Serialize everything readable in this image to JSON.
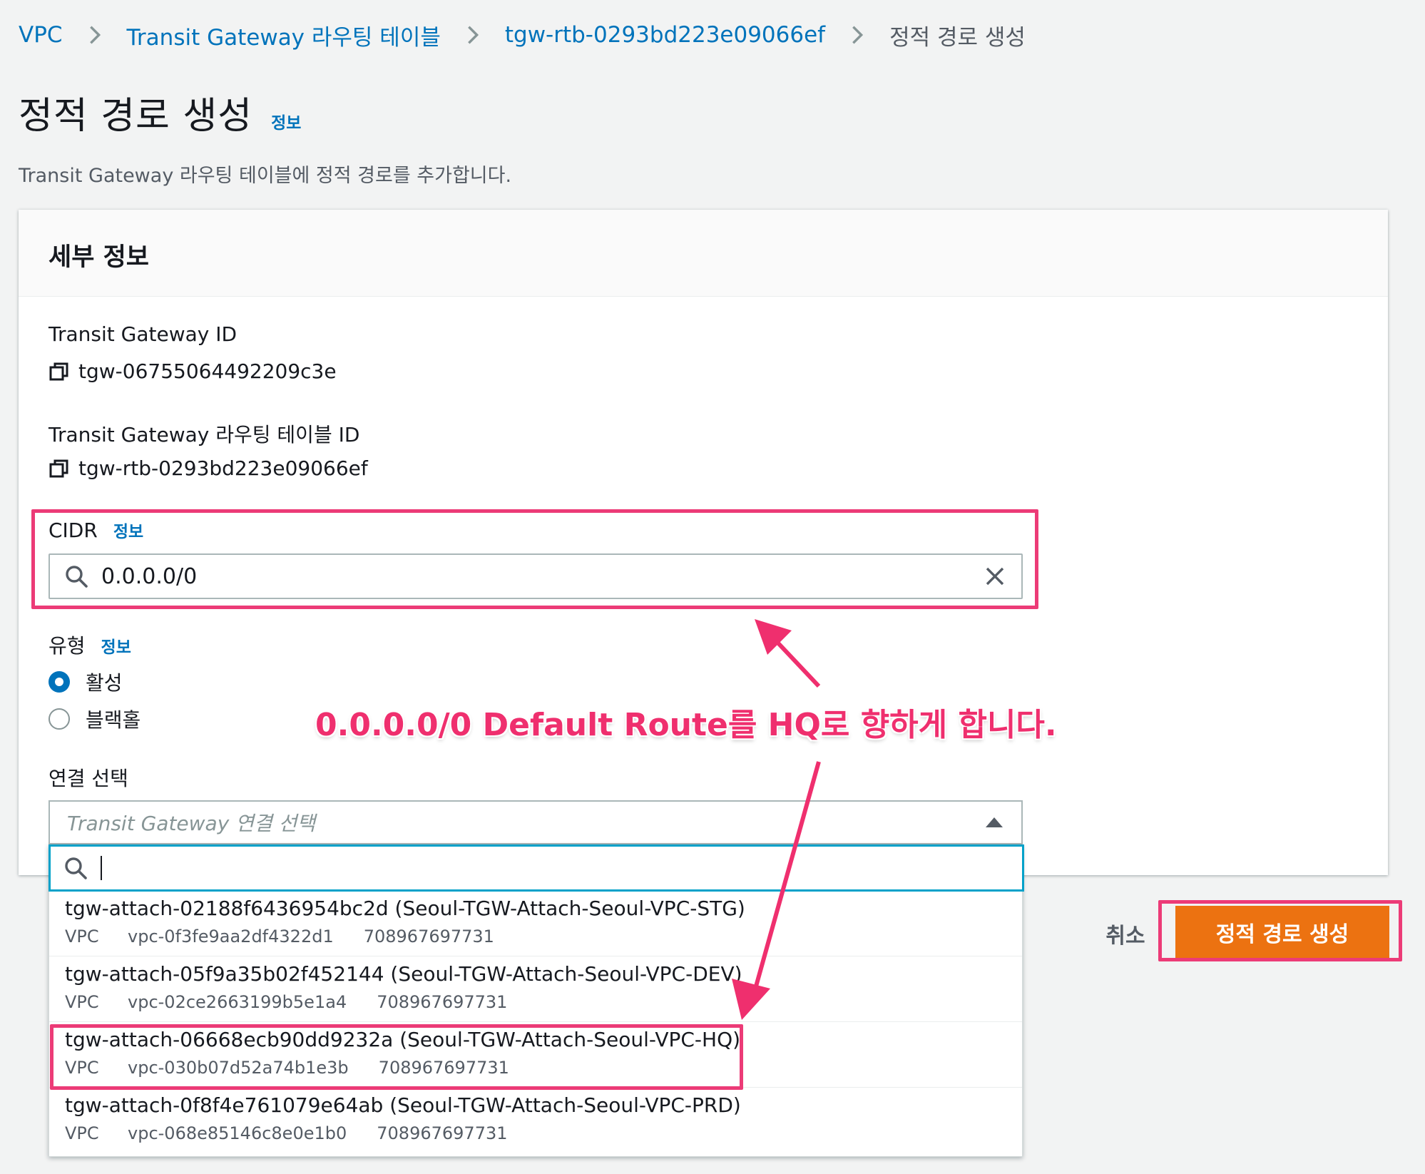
{
  "breadcrumb": {
    "items": [
      "VPC",
      "Transit Gateway 라우팅 테이블",
      "tgw-rtb-0293bd223e09066ef"
    ],
    "current": "정적 경로 생성"
  },
  "header": {
    "title": "정적 경로 생성",
    "info": "정보",
    "description": "Transit Gateway 라우팅 테이블에 정적 경로를 추가합니다."
  },
  "panel": {
    "title": "세부 정보",
    "tgw_id_label": "Transit Gateway ID",
    "tgw_id_value": "tgw-06755064492209c3e",
    "rtb_id_label": "Transit Gateway 라우팅 테이블 ID",
    "rtb_id_value": "tgw-rtb-0293bd223e09066ef",
    "cidr_label": "CIDR",
    "cidr_info": "정보",
    "cidr_value": "0.0.0.0/0",
    "type_label": "유형",
    "type_info": "정보",
    "type_options": [
      {
        "label": "활성",
        "checked": true
      },
      {
        "label": "블랙홀",
        "checked": false
      }
    ],
    "attachment_label": "연결 선택",
    "attachment_placeholder": "Transit Gateway 연결 선택",
    "search_value": ""
  },
  "dropdown": {
    "options": [
      {
        "name": "tgw-attach-02188f6436954bc2d (Seoul-TGW-Attach-Seoul-VPC-STG)",
        "type": "VPC",
        "resource": "vpc-0f3fe9aa2df4322d1",
        "account": "708967697731"
      },
      {
        "name": "tgw-attach-05f9a35b02f452144 (Seoul-TGW-Attach-Seoul-VPC-DEV)",
        "type": "VPC",
        "resource": "vpc-02ce2663199b5e1a4",
        "account": "708967697731"
      },
      {
        "name": "tgw-attach-06668ecb90dd9232a (Seoul-TGW-Attach-Seoul-VPC-HQ)",
        "type": "VPC",
        "resource": "vpc-030b07d52a74b1e3b",
        "account": "708967697731"
      },
      {
        "name": "tgw-attach-0f8f4e761079e64ab (Seoul-TGW-Attach-Seoul-VPC-PRD)",
        "type": "VPC",
        "resource": "vpc-068e85146c8e0e1b0",
        "account": "708967697731"
      }
    ]
  },
  "actions": {
    "cancel": "취소",
    "submit": "정적 경로 생성"
  },
  "annotation": {
    "text": "0.0.0.0/0 Default Route를 HQ로 향하게 합니다."
  },
  "icons": {
    "breadcrumb_separator": "chevron-right-icon",
    "copy": "copy-icon",
    "search": "search-icon",
    "clear": "close-icon",
    "dropdown_toggle": "caret-up-icon"
  },
  "colors": {
    "link": "#0073bb",
    "primary_button": "#ec7211",
    "annotation": "#ec3b77",
    "focus": "#00a1c9",
    "radio_checked": "#0073bb"
  }
}
